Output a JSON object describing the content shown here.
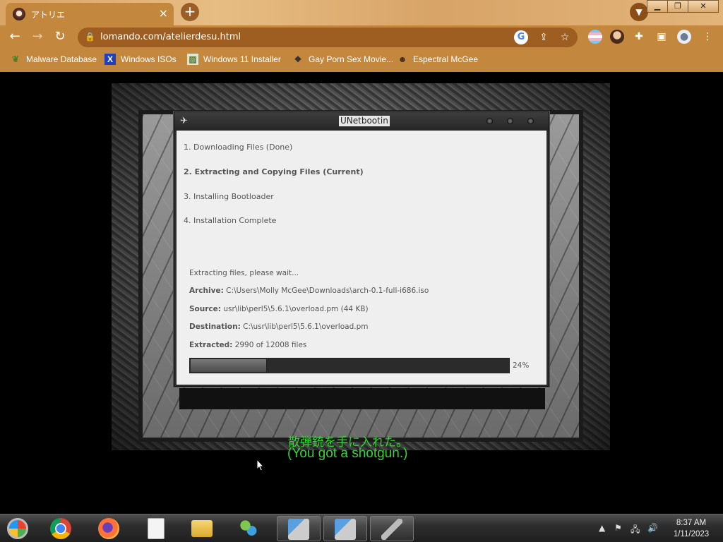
{
  "browser": {
    "tab": {
      "title": "アトリエ"
    },
    "url": "lomando.com/atelierdesu.html",
    "bookmarks": [
      {
        "label": "Malware Database",
        "icon": "leaf-icon"
      },
      {
        "label": "Windows ISOs",
        "icon": "x-icon"
      },
      {
        "label": "Windows 11 Installer",
        "icon": "image-icon"
      },
      {
        "label": "Gay Porn Sex Movie...",
        "icon": "box-icon"
      },
      {
        "label": "Espectral McGee",
        "icon": "face-icon"
      }
    ],
    "theme_color": "#c4873e"
  },
  "unetbootin": {
    "title": "UNetbootin",
    "steps": [
      "1. Downloading Files (Done)",
      "2. Extracting and Copying Files (Current)",
      "3. Installing Bootloader",
      "4. Installation Complete"
    ],
    "status": "Extracting files, please wait...",
    "archive_label": "Archive:",
    "archive": "C:\\Users\\Molly McGee\\Downloads\\arch-0.1-full-i686.iso",
    "source_label": "Source:",
    "source": "usr\\lib\\perl5\\5.6.1\\overload.pm (44 KB)",
    "destination_label": "Destination:",
    "destination": "C:\\usr\\lib\\perl5\\5.6.1\\overload.pm",
    "extracted_label": "Extracted:",
    "extracted": "2990 of 12008 files",
    "progress_text": "24%",
    "progress_value": 0.24
  },
  "game": {
    "subtitle_jp": "散弾銃を手に入れた。",
    "subtitle_en": "(You got a shotgun.)",
    "subtitle_color": "#2fd82f"
  },
  "taskbar": {
    "apps": [
      "start-orb-icon",
      "chrome-icon",
      "firefox-icon",
      "document-icon",
      "folder-icon",
      "network-people-icon",
      "installer-icon",
      "installer-icon",
      "unetbootin-icon"
    ],
    "time": "8:37 AM",
    "date": "1/11/2023"
  }
}
